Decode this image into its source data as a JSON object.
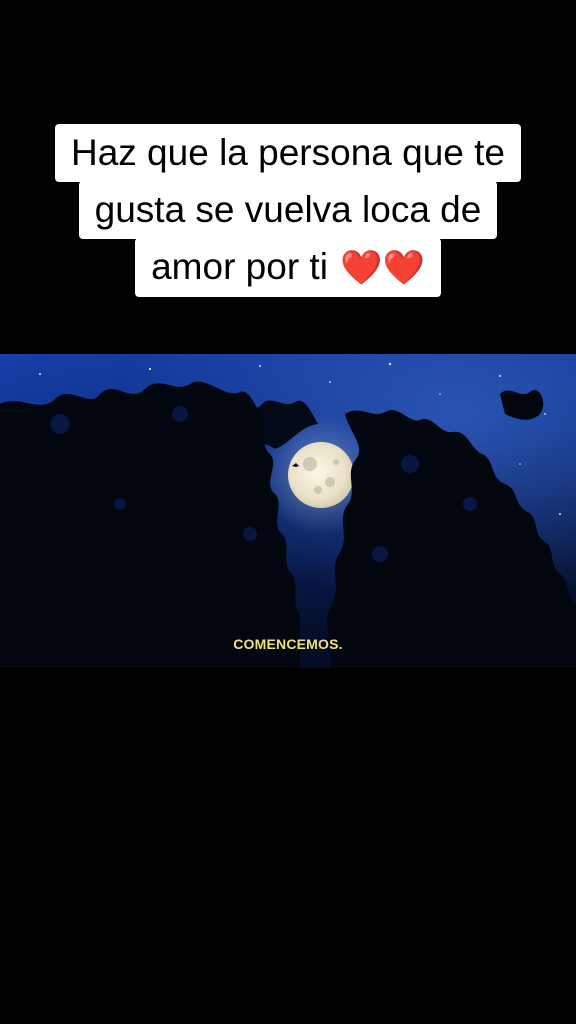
{
  "caption": {
    "lines": [
      "Haz que la persona que te",
      "gusta se vuelva loca de",
      "amor por ti"
    ],
    "emoji": "❤️❤️",
    "emoji_names": [
      "red-heart-icon",
      "red-heart-icon"
    ]
  },
  "video": {
    "subtitle": "COMENCEMOS.",
    "scene": [
      "night-sky",
      "full-moon",
      "tree-silhouettes"
    ],
    "colors": {
      "sky_top": "#0d2f8f",
      "sky_bottom": "#06102e",
      "moon": "#efe8d2",
      "subtitle": "#f2e27a"
    }
  },
  "theme": {
    "background": "#000000",
    "caption_bg": "#ffffff",
    "caption_text": "#000000",
    "heart": "#d0101c"
  }
}
